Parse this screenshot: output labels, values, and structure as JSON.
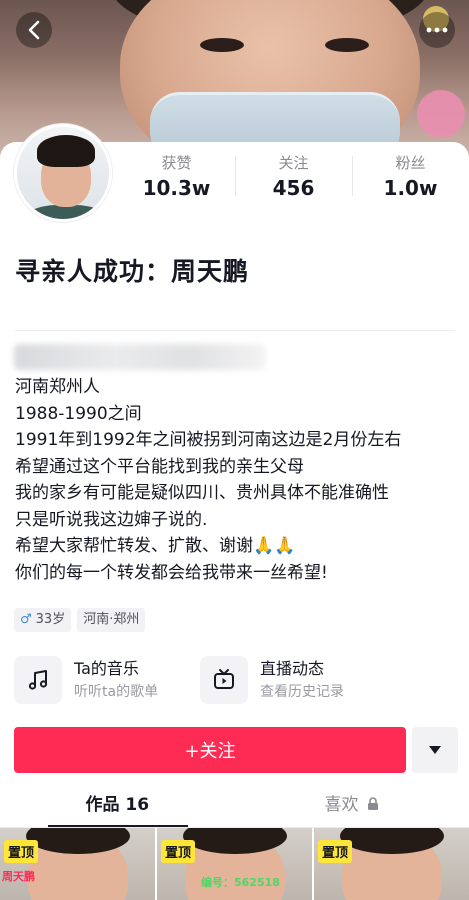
{
  "nav": {
    "back_icon": "chevron-left-icon",
    "more_icon": "more-dots-icon"
  },
  "stats": [
    {
      "label": "获赞",
      "value": "10.3w"
    },
    {
      "label": "关注",
      "value": "456"
    },
    {
      "label": "粉丝",
      "value": "1.0w"
    }
  ],
  "profile": {
    "name": "寻亲人成功：周天鹏",
    "bio": [
      "河南郑州人",
      "1988-1990之间",
      "1991年到1992年之间被拐到河南这边是2月份左右",
      "希望通过这个平台能找到我的亲生父母",
      "我的家乡有可能是疑似四川、贵州具体不能准确性",
      "只是听说我这边婶子说的.",
      "希望大家帮忙转发、扩散、谢谢🙏🙏",
      "你们的每一个转发都会给我带来一丝希望!"
    ],
    "tags": {
      "gender_symbol": "♂",
      "age": "33岁",
      "location": "河南·郑州"
    }
  },
  "entries": [
    {
      "title": "Ta的音乐",
      "subtitle": "听听ta的歌单",
      "icon": "music-note-icon"
    },
    {
      "title": "直播动态",
      "subtitle": "查看历史记录",
      "icon": "tv-play-icon"
    }
  ],
  "actions": {
    "follow_label": "+关注",
    "dropdown_icon": "triangle-down-icon"
  },
  "tabs": [
    {
      "label": "作品 16",
      "active": true
    },
    {
      "label": "喜欢",
      "active": false,
      "icon": "lock-icon"
    }
  ],
  "videos": [
    {
      "pin": "置顶",
      "caption": "周天鹏"
    },
    {
      "pin": "置顶",
      "caption": "编号：562518"
    },
    {
      "pin": "置顶",
      "caption": ""
    }
  ],
  "colors": {
    "accent": "#fe2c55",
    "pin": "#fde53a",
    "gender": "#3a8ee6"
  }
}
